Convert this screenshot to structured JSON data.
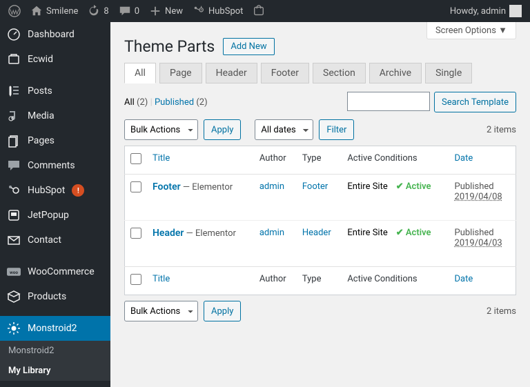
{
  "adminbar": {
    "site_name": "Smilene",
    "updates": "8",
    "comments": "0",
    "new": "New",
    "hubspot": "HubSpot",
    "howdy": "Howdy, admin"
  },
  "sidebar": {
    "items": [
      {
        "label": "Dashboard"
      },
      {
        "label": "Ecwid"
      },
      {
        "label": "Posts"
      },
      {
        "label": "Media"
      },
      {
        "label": "Pages"
      },
      {
        "label": "Comments"
      },
      {
        "label": "HubSpot",
        "badge": "!"
      },
      {
        "label": "JetPopup"
      },
      {
        "label": "Contact"
      },
      {
        "label": "WooCommerce"
      },
      {
        "label": "Products"
      },
      {
        "label": "Monstroid2"
      }
    ],
    "submenu": [
      {
        "label": "Monstroid2"
      },
      {
        "label": "My Library"
      }
    ]
  },
  "screen_options": "Screen Options ▼",
  "page": {
    "title": "Theme Parts",
    "add_new": "Add New"
  },
  "tabs": [
    "All",
    "Page",
    "Header",
    "Footer",
    "Section",
    "Archive",
    "Single"
  ],
  "subsub": {
    "all": "All",
    "all_count": "(2)",
    "sep": "|",
    "published": "Published",
    "published_count": "(2)"
  },
  "search_btn": "Search Template",
  "bulk_actions": "Bulk Actions",
  "apply": "Apply",
  "all_dates": "All dates",
  "filter": "Filter",
  "items_count": "2 items",
  "cols": {
    "title": "Title",
    "author": "Author",
    "type": "Type",
    "active": "Active Conditions",
    "date": "Date"
  },
  "rows": [
    {
      "title": "Footer",
      "state": " — Elementor",
      "author": "admin",
      "type": "Footer",
      "cond": "Entire Site",
      "active": "✔ Active",
      "status": "Published",
      "date": "2019/04/08"
    },
    {
      "title": "Header",
      "state": " — Elementor",
      "author": "admin",
      "type": "Header",
      "cond": "Entire Site",
      "active": "✔ Active",
      "status": "Published",
      "date": "2019/04/03"
    }
  ]
}
